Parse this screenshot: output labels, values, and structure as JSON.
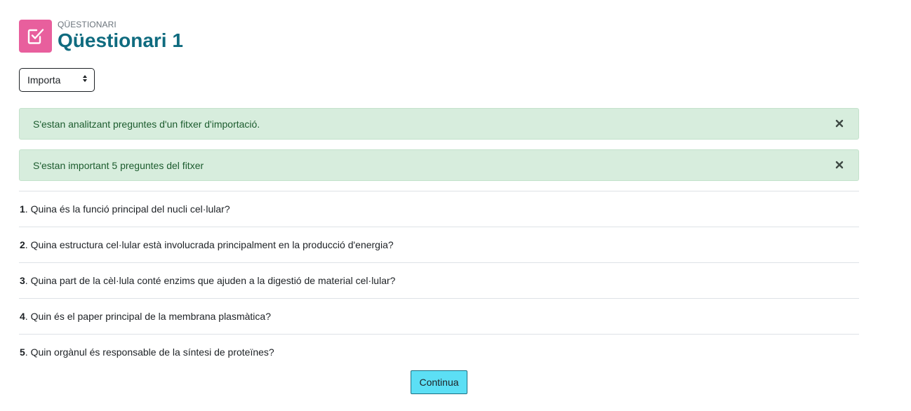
{
  "header": {
    "icon": "checkbox-icon",
    "eyebrow": "QÜESTIONARI",
    "title": "Qüestionari 1",
    "icon_color": "#e85f9d",
    "title_color": "#0f6b7f"
  },
  "action_select": {
    "selected": "Importa",
    "icon": "sort-caret-icon"
  },
  "alerts": [
    {
      "message": "S'estan analitzant preguntes d'un fitxer d'importació.",
      "close_icon": "close-icon"
    },
    {
      "message": "S'estan important 5 preguntes del fitxer",
      "close_icon": "close-icon"
    }
  ],
  "alert_colors": {
    "background": "#d7eddd",
    "text": "#1c5c2e"
  },
  "questions": [
    {
      "number": "1",
      "text": ". Quina és la funció principal del nucli cel·lular?"
    },
    {
      "number": "2",
      "text": ". Quina estructura cel·lular està involucrada principalment en la producció d'energia?"
    },
    {
      "number": "3",
      "text": ". Quina part de la cèl·lula conté enzims que ajuden a la digestió de material cel·lular?"
    },
    {
      "number": "4",
      "text": ". Quin és el paper principal de la membrana plasmàtica?"
    },
    {
      "number": "5",
      "text": ". Quin orgànul és responsable de la síntesi de proteïnes?"
    }
  ],
  "continue_button": {
    "label": "Continua",
    "color": "#5cdff5"
  }
}
